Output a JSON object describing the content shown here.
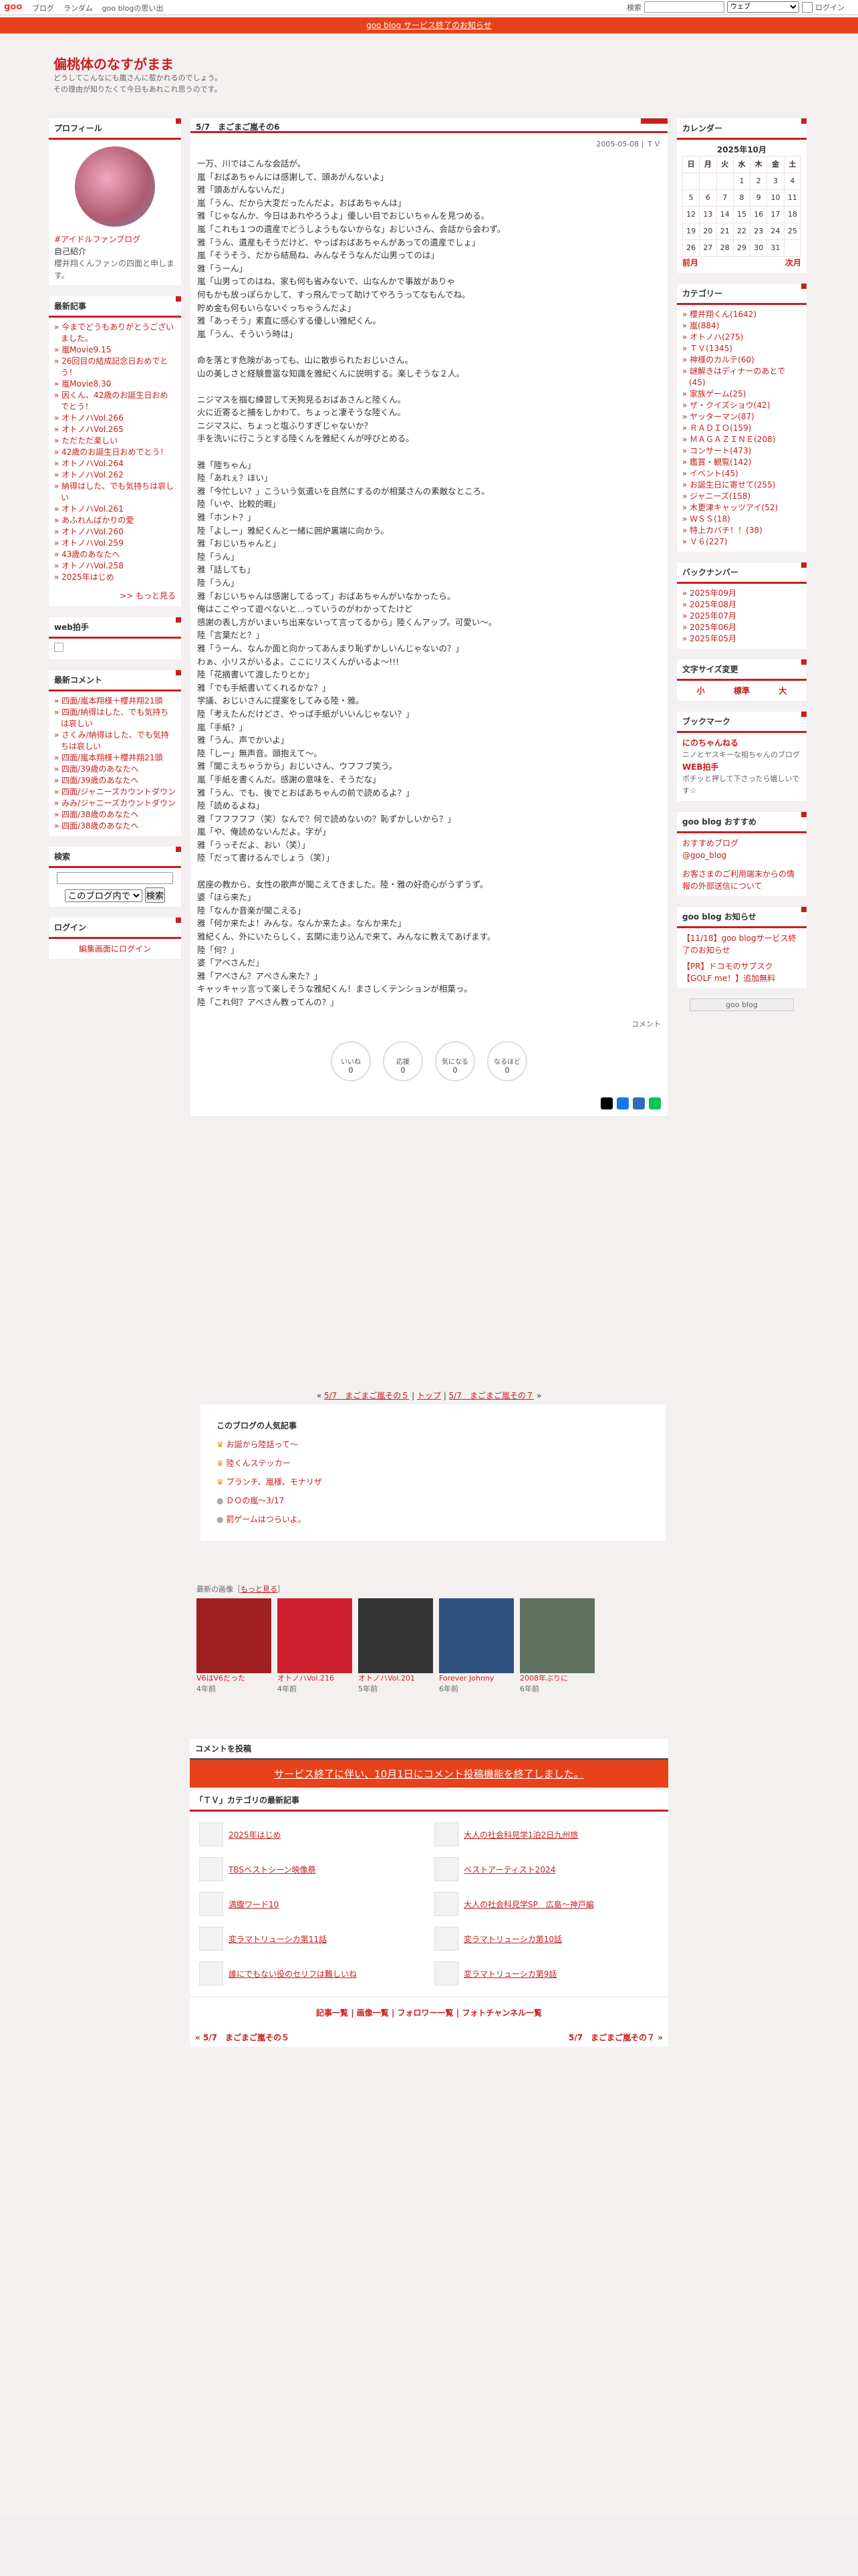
{
  "topbar": {
    "logo": "goo",
    "nav": [
      "ブログ",
      "ランダム",
      "goo blogの思い出"
    ],
    "search_label": "検索",
    "search_option": "ウェブ",
    "login": "ログイン"
  },
  "notice": "goo blog サービス終了のお知らせ",
  "blog": {
    "title": "偏桃体のなすがまま",
    "desc1": "どうしてこんなにも嵐さんに惹かれるのでしょう。",
    "desc2": "その理由が知りたくて今日もあれこれ思うのです。"
  },
  "profile": {
    "title": "プロフィール",
    "name": "#アイドルファンブログ",
    "intro_title": "自己紹介",
    "intro": "櫻井翔くんファンの四面と申します。"
  },
  "recent": {
    "title": "最新記事",
    "items": [
      "今までどうもありがとうございました。",
      "嵐Movie9.15",
      "26回目の結成記念日おめでとう！",
      "嵐Movie8.30",
      "因くん、42歳のお誕生日おめでとう！",
      "オトノハVol.266",
      "オトノハVol.265",
      "ただただ楽しい",
      "42歳のお誕生日おめでとう！",
      "オトノハVol.264",
      "オトノハVol.262",
      "納得はした、でも気持ちは哀しい",
      "オトノハVol.261",
      "あふれんばかりの愛",
      "オトノハVol.260",
      "オトノハVol.259",
      "43歳のあなたへ",
      "オトノハVol.258",
      "2025年はじめ"
    ],
    "more": ">> もっと見る"
  },
  "webclap": {
    "title": "web拍手"
  },
  "comments": {
    "title": "最新コメント",
    "items": [
      "四面/嵐本翔様＋櫻井翔21頭",
      "四面/納得はした、でも気持ちは哀しい",
      "さくみ/納得はした、でも気持ちは哀しい",
      "四面/嵐本翔様＋櫻井翔21頭",
      "四面/39歳のあなたへ",
      "四面/39歳のあなたへ",
      "四面/ジャニーズカウントダウン",
      "みみ/ジャニーズカウントダウン",
      "四面/38歳のあなたへ",
      "四面/38歳のあなたへ"
    ]
  },
  "search": {
    "title": "検索",
    "option": "このブログ内で",
    "button": "検索"
  },
  "login": {
    "title": "ログイン",
    "link": "編集画面にログイン"
  },
  "post": {
    "title": "5/7　まごまご嵐その6",
    "date": "2005-05-08 | ＴＶ",
    "body": "一万、川ではこんな会話が。\n嵐「おばあちゃんには感謝して、頭あがんないよ」\n雅「頭あがんないんだ」\n嵐「うん、だから大変だったんだよ。おばあちゃんは」\n雅「じゃなんか、今日はあれやろうよ」優しい目でおじいちゃんを見つめる。\n嵐「これも１つの遺産でどうしようもないからな」おじいさん、会話から会わず。\n雅「うん、遺産もそうだけど、やっぱおばあちゃんがあっての遺産でしょ」\n嵐「そうそう、だから結局ね、みんなそうなんだ山男ってのは」\n雅「うーん」\n嵐「山男ってのはね、家も何も省みないで、山なんかで事故がありゃ\n何もかも放っぽらかして、すっ飛んでって助けてやろうってなもんでね。\n貯め金も何もいらないぐっちゃうんだよ」\n雅「あっそう」素直に感心する優しい雅紀くん。\n嵐「うん、そういう時は」\n\n命を落とす危険があっても、山に散歩られたおじいさん。\n山の美しさと経験豊富な知識を雅紀くんに説明する。楽しそうな２人。\n\nニジマスを掴む練習して天狗見るおばあさんと陸くん。\n火に近寄ると捕をしかわて、ちょっと凄そうな陸くん。\nニジマスに、ちょっと塩ふりすぎじゃないか？\n手を洗いに行こうとする陸くんを雅紀くんが呼びとめる。\n\n雅「陸ちゃん」\n陸「あれぇ？ほい」\n雅「今忙しい？」こういう気遣いを自然にするのが相葉さんの素敵なところ。\n陸「いや、比較的暇」\n雅「ホント？」\n陸「よしー」雅紀くんと一緒に囲炉裏端に向かう。\n雅「おじいちゃんと」\n陸「うん」\n雅「話しても」\n陸「うん」\n雅「おじいちゃんは感謝してるって」おばあちゃんがいなかったら。\n俺はここやって遊べないと...っていうのがわかってたけど\n感謝の表し方がいまいち出来ないって言ってるから」陸くんアップ。可愛い〜。\n陸「言葉だと？」\n雅「うーん、なんか面と向かってあんまり恥ずかしいんじゃないの？」\nわぁ、小リスがいるよ。ここにリスくんがいるよ〜!!!\n陸「花摘書いて渡したりとか」\n雅「でも手紙書いてくれるかな？」\n学議、おじいさんに提案をしてみる陸・雅。\n陸「考えたんだけどさ、やっぱ手紙がいいんじゃない？」\n嵐「手紙？」\n雅「うん、声でかいよ」\n陸「しー」無声音。頭抱えて〜。\n雅「聞こえちゃうから」おじいさん、ウフフブ笑う。\n嵐「手紙を書くんだ。感謝の意味を、そうだな」\n雅「うん、でも、後でとおばあちゃんの前で読めるよ？」\n陸「読めるよね」\n雅「フフフフフ（笑）なんで？何で読めないの？恥ずかしいから？」\n嵐「や、俺読めないんだよ。字が」\n雅「うっそだよ、おい（笑）」\n陸「だって書けるんでしょう（笑）」\n\n居座の教から、女性の歌声が聞こえてきました。陸・雅の好奇心がうずうず。\n婆「ほら来た」\n陸「なんか音楽が聞こえる」\n雅「何か来たよ！みんな。なんか来たよ。なんか来た」\n雅紀くん、外にいたらしく、玄関に走り込んで来て、みんなに教えてあげます。\n陸「何？」\n婆「アベさんだ」\n雅「アベさん？アベさん来た？」\nキャッキャッ言って楽しそうな雅紀くん！まさしくテンションが相葉っ。\n陸「これ何？アベさん教ってんの？」",
    "comment_label": "コメント"
  },
  "reactions": [
    {
      "label": "いいね",
      "count": "0"
    },
    {
      "label": "応援",
      "count": "0"
    },
    {
      "label": "気になる",
      "count": "0"
    },
    {
      "label": "なるほど",
      "count": "0"
    }
  ],
  "postnav": {
    "prev": "5/7　まごまご嵐その５",
    "top": "トップ",
    "next": "5/7　まごまご嵐その７"
  },
  "popular": {
    "title": "このブログの人気記事",
    "items": [
      "お誕から陸話って〜",
      "陸くんステッカー",
      "ブランチ、嵐様、モナリザ",
      "ＤＯの嵐〜3/17",
      "罰ゲームはつらいよ。"
    ]
  },
  "images": {
    "title": "最新の画像",
    "more": "もっと見る",
    "items": [
      {
        "title": "V6はV6だった",
        "age": "4年前",
        "color": "#a02020"
      },
      {
        "title": "オトノハVol.216",
        "age": "4年前",
        "color": "#d02030"
      },
      {
        "title": "オトノハVol.201",
        "age": "5年前",
        "color": "#333333"
      },
      {
        "title": "Forever Johnny",
        "age": "6年前",
        "color": "#305080"
      },
      {
        "title": "2008年ぶりに",
        "age": "6年前",
        "color": "#607060"
      }
    ]
  },
  "comment_post": {
    "title": "コメントを投稿",
    "closed": "サービス終了に伴い、10月1日にコメント投稿機能を終了しました。"
  },
  "tv_cat": {
    "title": "「ＴＶ」カテゴリの最新記事",
    "items": [
      "2025年はじめ",
      "大人の社会科見学1泊2日九州旅",
      "TBSベストシーン映像祭",
      "ベストアーティスト2024",
      "満腹ワード10",
      "大人の社会科見学SP　広島〜神戸編",
      "変ラマトリューシカ第11話",
      "変ラマトリューシカ第10話",
      "誰にでもない役のセリフは難しいね",
      "変ラマトリューシカ第9話"
    ]
  },
  "footerlinks": [
    "記事一覧",
    "画像一覧",
    "フォロワー一覧",
    "フォトチャンネル一覧"
  ],
  "calendar": {
    "title": "カレンダー",
    "month": "2025年10月",
    "days": [
      "日",
      "月",
      "火",
      "水",
      "木",
      "金",
      "土"
    ],
    "rows": [
      [
        "",
        "",
        "",
        "1",
        "2",
        "3",
        "4"
      ],
      [
        "5",
        "6",
        "7",
        "8",
        "9",
        "10",
        "11"
      ],
      [
        "12",
        "13",
        "14",
        "15",
        "16",
        "17",
        "18"
      ],
      [
        "19",
        "20",
        "21",
        "22",
        "23",
        "24",
        "25"
      ],
      [
        "26",
        "27",
        "28",
        "29",
        "30",
        "31",
        ""
      ]
    ],
    "prev": "前月",
    "next": "次月"
  },
  "categories": {
    "title": "カテゴリー",
    "items": [
      "櫻井翔くん(1642)",
      "嵐(884)",
      "オトノハ(275)",
      "ＴＶ(1345)",
      "神様のカルテ(60)",
      "謎解きはディナーのあとで(45)",
      "家族ゲーム(25)",
      "ザ・クイズショウ(42)",
      "ヤッターマン(87)",
      "ＲＡＤＩＯ(159)",
      "ＭＡＧＡＺＩＮＥ(208)",
      "コンサート(473)",
      "鑑賞・観覧(142)",
      "イベント(45)",
      "お誕生日に寄せて(255)",
      "ジャニーズ(158)",
      "木更津キャッツアイ(52)",
      "ＷＳＳ(18)",
      "特上カバチ！！(38)",
      "Ｖ６(227)"
    ]
  },
  "backnumber": {
    "title": "バックナンバー",
    "items": [
      "2025年09月",
      "2025年08月",
      "2025年07月",
      "2025年06月",
      "2025年05月"
    ]
  },
  "fontsize": {
    "title": "文字サイズ変更",
    "small": "小",
    "mid": "標準",
    "large": "大"
  },
  "bookmark": {
    "title": "ブックマーク",
    "items": [
      {
        "name": "にのちゃんねる",
        "desc": "ニノとヤスキーな相ちゃんのブログ"
      },
      {
        "name": "WEB拍手",
        "desc": "ポチッと押して下さったら嬉しいです☆"
      }
    ]
  },
  "recommend": {
    "title": "goo blog おすすめ",
    "items": [
      "おすすめブログ",
      "@goo_blog"
    ],
    "note": "お客さまのご利用端末からの情報の外部送信について"
  },
  "notice_box": {
    "title": "goo blog お知らせ",
    "items": [
      "【11/18】goo blogサービス終了のお知らせ",
      "【PR】ドコモのサブスク【GOLF me！】追加無料"
    ],
    "badge": "goo blog"
  }
}
